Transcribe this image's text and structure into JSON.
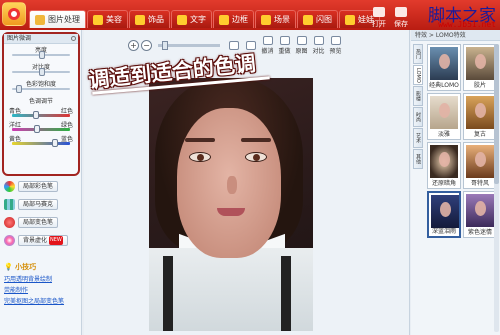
{
  "tabs": [
    {
      "label": "图片处理"
    },
    {
      "label": "美容"
    },
    {
      "label": "饰品"
    },
    {
      "label": "文字"
    },
    {
      "label": "边框"
    },
    {
      "label": "场景"
    },
    {
      "label": "闪图"
    },
    {
      "label": "娃娃"
    }
  ],
  "top_tools": {
    "open": "打开",
    "save": "保存"
  },
  "watermark": {
    "site": "脚本之家",
    "url": "www.Jb51.net"
  },
  "adjust_panel": {
    "title": "图片微调",
    "sliders": [
      {
        "label": "亮度",
        "value": 0.5
      },
      {
        "label": "对比度",
        "value": 0.5
      },
      {
        "label": "色彩饱和度",
        "value": 0.12
      }
    ],
    "color_title": "色调调节",
    "color_sliders": [
      {
        "left": "青色",
        "right": "红色",
        "value": 0.4
      },
      {
        "left": "洋红",
        "right": "绿色",
        "value": 0.42
      },
      {
        "left": "黄色",
        "right": "蓝色",
        "value": 0.72
      }
    ]
  },
  "side_buttons": [
    {
      "label": "局部彩色笔",
      "icon": "color-pen-icon"
    },
    {
      "label": "局部马赛克",
      "icon": "mosaic-icon"
    },
    {
      "label": "局部变色笔",
      "icon": "recolor-pen-icon"
    },
    {
      "label": "背景虚化",
      "icon": "blur-icon",
      "tag": "NEW"
    }
  ],
  "tips": {
    "title": "小技巧",
    "links": [
      "巧用透明背景绘制",
      "荧能制作",
      "完美抠图之局部变色笔"
    ]
  },
  "canvas_toolbar": {
    "buttons": [
      "撤消",
      "重做",
      "原图",
      "对比",
      "预览"
    ]
  },
  "headline": "调适到适合的色调",
  "right_panel": {
    "title": "特效 > LOMO特效",
    "vtabs": [
      "热门",
      "LOMO",
      "影楼",
      "时尚",
      "艺术",
      "其他"
    ],
    "thumbs": [
      {
        "label": "经典LOMO"
      },
      {
        "label": "胶片"
      },
      {
        "label": "淡雅"
      },
      {
        "label": "复古"
      },
      {
        "label": "还原暗角"
      },
      {
        "label": "哥特风"
      },
      {
        "label": "深蓝泪雨"
      },
      {
        "label": "紫色迷情"
      }
    ]
  }
}
